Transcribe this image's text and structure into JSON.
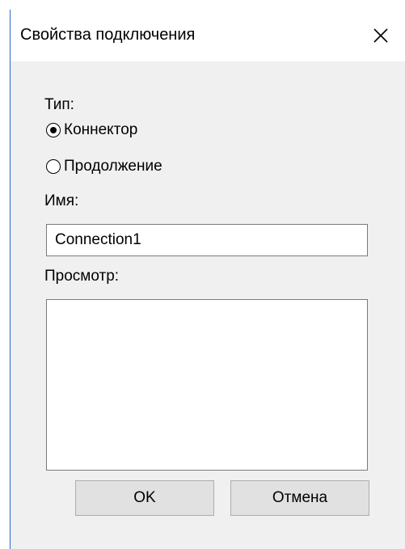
{
  "dialog": {
    "title": "Свойства подключения",
    "close_icon": "close-icon"
  },
  "type_section": {
    "label": "Тип:",
    "options": [
      {
        "label": "Коннектор",
        "checked": true
      },
      {
        "label": "Продолжение",
        "checked": false
      }
    ]
  },
  "name_section": {
    "label": "Имя:",
    "value": "Connection1"
  },
  "preview_section": {
    "label": "Просмотр:"
  },
  "buttons": {
    "ok_label": "OK",
    "cancel_label": "Отмена"
  }
}
